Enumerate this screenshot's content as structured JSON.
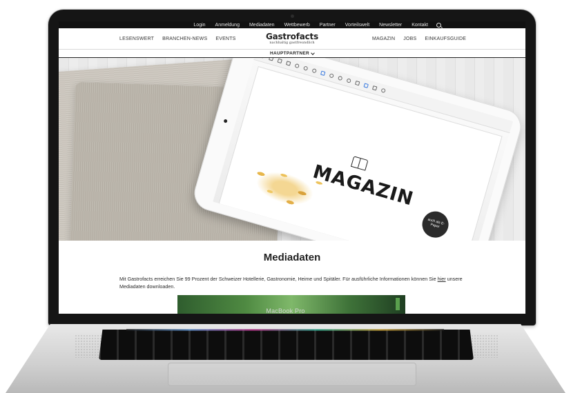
{
  "device": {
    "label": "MacBook Pro"
  },
  "topbar": {
    "links": [
      "Login",
      "Anmeldung",
      "Mediadaten",
      "Wettbewerb",
      "Partner",
      "Vorteilswelt",
      "Newsletter",
      "Kontakt"
    ],
    "search_icon": "search-icon"
  },
  "logo": {
    "title": "Gastrofacts",
    "subtitle": "nachhaltig gastfreundlich"
  },
  "mainnav": {
    "left": [
      "LESENSWERT",
      "BRANCHEN-NEWS",
      "EVENTS"
    ],
    "right": [
      "MAGAZIN",
      "JOBS",
      "EINKAUFSGUIDE"
    ]
  },
  "subnav": {
    "label": "HAUPTPARTNER",
    "icon": "chevron-down-icon"
  },
  "hero": {
    "magazine_word": "MAGAZIN",
    "badge_text": "auch als E-Paper"
  },
  "content": {
    "title": "Mediadaten",
    "intro_text": "Mit Gastrofacts erreichen Sie 99 Prozent der Schweizer Hotellerie, Gastronomie, Heime und Spitäler. Für ausführliche Informationen können Sie ",
    "intro_link": "hier",
    "intro_tail": " unsere Mediadaten downloaden."
  },
  "colors": {
    "topbar": "#111111",
    "text": "#222222",
    "accent_green": "#4f8a42"
  }
}
